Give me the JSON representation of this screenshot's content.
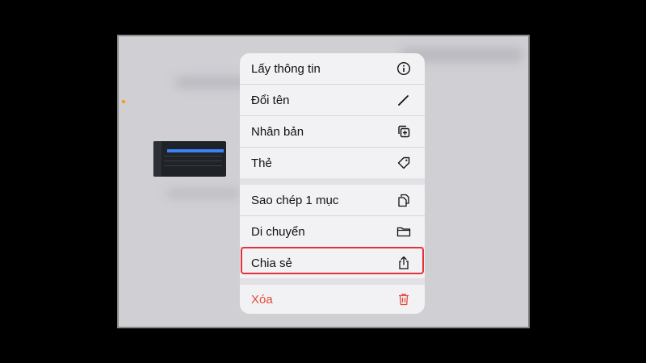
{
  "menu": {
    "items": [
      {
        "label": "Lấy thông tin",
        "icon": "info-icon"
      },
      {
        "label": "Đổi tên",
        "icon": "pencil-icon"
      },
      {
        "label": "Nhân bản",
        "icon": "duplicate-icon"
      },
      {
        "label": "Thẻ",
        "icon": "tag-icon"
      },
      {
        "label": "Sao chép 1 mục",
        "icon": "copy-icon"
      },
      {
        "label": "Di chuyển",
        "icon": "folder-icon"
      },
      {
        "label": "Chia sẻ",
        "icon": "share-icon"
      },
      {
        "label": "Xóa",
        "icon": "trash-icon"
      }
    ]
  },
  "colors": {
    "destructive": "#e5483d",
    "highlight_border": "#e0343b",
    "background_dim": "#cfcfd4"
  }
}
